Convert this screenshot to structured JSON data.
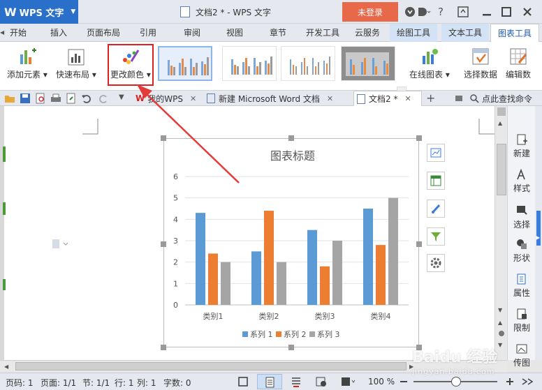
{
  "titlebar": {
    "app_name": "WPS 文字",
    "document_title": "文档2 * - WPS 文字",
    "login_label": "未登录",
    "help_label": "?",
    "icons": [
      "skin-icon",
      "theme-icon",
      "help-icon",
      "minimize-icon",
      "maximize-icon",
      "close-icon"
    ]
  },
  "ribbon_tabs": [
    "开始",
    "插入",
    "页面布局",
    "引用",
    "审阅",
    "视图",
    "章节",
    "开发工具",
    "云服务",
    "绘图工具",
    "文本工具",
    "图表工具"
  ],
  "ribbon": {
    "add_element": "添加元素",
    "quick_layout": "快速布局",
    "change_color": "更改颜色",
    "online_chart": "在线图表",
    "select_data": "选择数据",
    "edit_data": "编辑数"
  },
  "doc_tabs": {
    "my_wps": "我的WPS",
    "word_doc": "新建 Microsoft Word 文档",
    "doc2": "文档2 *",
    "search": "点此查找命令"
  },
  "right_panel": [
    "新建",
    "样式",
    "选择",
    "形状",
    "属性",
    "限制",
    "传图"
  ],
  "chart_data": {
    "type": "bar",
    "title": "图表标题",
    "categories": [
      "类别1",
      "类别2",
      "类别3",
      "类别4"
    ],
    "series": [
      {
        "name": "系列 1",
        "values": [
          4.3,
          2.5,
          3.5,
          4.5
        ],
        "color": "#5b9bd5"
      },
      {
        "name": "系列 2",
        "values": [
          2.4,
          4.4,
          1.8,
          2.8
        ],
        "color": "#ed7d31"
      },
      {
        "name": "系列 3",
        "values": [
          2.0,
          2.0,
          3.0,
          5.0
        ],
        "color": "#a5a5a5"
      }
    ],
    "ylim": [
      0,
      6
    ],
    "yticks": [
      "0",
      "1",
      "2",
      "3",
      "4",
      "5",
      "6"
    ],
    "grid": true,
    "legend": "bottom"
  },
  "status": {
    "page": "页码: 1",
    "pages": "页面: 1/1",
    "section": "节: 1/1",
    "row": "行: 1",
    "col": "列: 1",
    "words": "字数: 0",
    "zoom": "100 %"
  },
  "watermark": {
    "brand": "Baidu 经验",
    "url": "jingyan.baidu.com"
  }
}
